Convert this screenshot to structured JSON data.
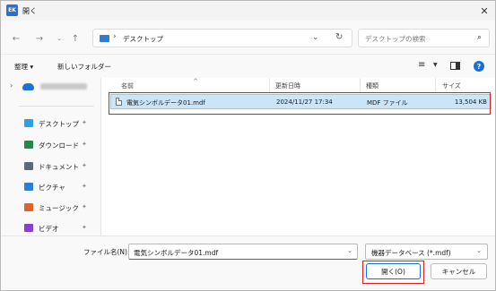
{
  "window": {
    "title": "開く",
    "app_icon": "EK"
  },
  "nav": {
    "address_path": "デスクトップ",
    "search_placeholder": "デスクトップの検索"
  },
  "toolbar": {
    "organize_label": "整理 ▾",
    "new_folder_label": "新しいフォルダー"
  },
  "sidebar": {
    "items": [
      {
        "label": "デスクトップ",
        "icon": "desktop-icon",
        "color": "#2aa0e6"
      },
      {
        "label": "ダウンロード",
        "icon": "download-icon",
        "color": "#1f8a4c"
      },
      {
        "label": "ドキュメント",
        "icon": "document-icon",
        "color": "#5a6b80"
      },
      {
        "label": "ピクチャ",
        "icon": "pictures-icon",
        "color": "#2d7fd3"
      },
      {
        "label": "ミュージック",
        "icon": "music-icon",
        "color": "#e3622a"
      },
      {
        "label": "ビデオ",
        "icon": "video-icon",
        "color": "#8a3fd1"
      }
    ]
  },
  "columns": {
    "name": "名前",
    "date": "更新日時",
    "type": "種類",
    "size": "サイズ"
  },
  "files": [
    {
      "name": "電気シンボルデータ01.mdf",
      "date": "2024/11/27 17:34",
      "type": "MDF ファイル",
      "size": "13,504 KB"
    }
  ],
  "bottom": {
    "filename_label": "ファイル名(N):",
    "filename_value": "電気シンボルデータ01.mdf",
    "filetype_value": "機器データベース (*.mdf)",
    "open_label": "開く(O)",
    "cancel_label": "キャンセル"
  },
  "colors": {
    "accent": "#1a6fd1",
    "selection": "#cce4f7",
    "highlight_box": "#d32222"
  }
}
